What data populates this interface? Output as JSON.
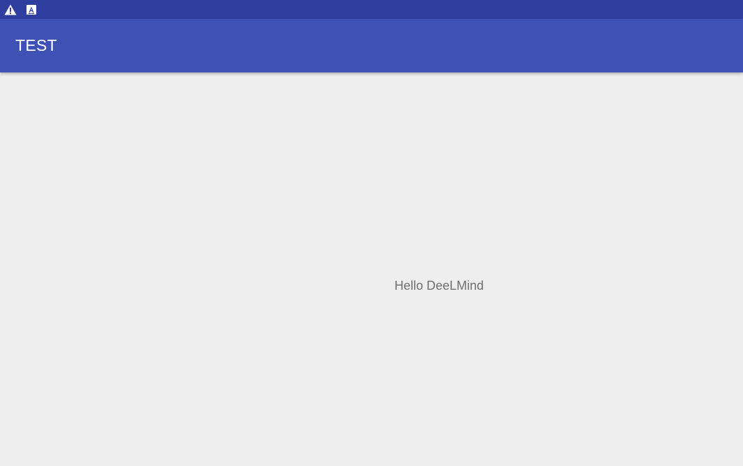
{
  "status_bar": {
    "background": "#303f9f",
    "icons": [
      "warning-icon",
      "text-a-icon"
    ]
  },
  "app_bar": {
    "title": "TEST",
    "background": "#3f51b5"
  },
  "content": {
    "background": "#eeeeee",
    "text": "Hello DeeLMind"
  }
}
